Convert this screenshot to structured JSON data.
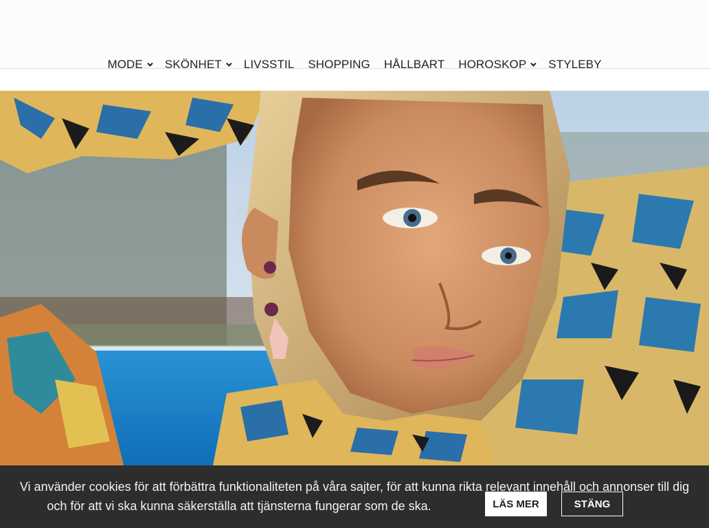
{
  "nav": {
    "items": [
      {
        "label": "MODE",
        "has_dropdown": true
      },
      {
        "label": "SKÖNHET",
        "has_dropdown": true
      },
      {
        "label": "LIVSSTIL",
        "has_dropdown": false
      },
      {
        "label": "SHOPPING",
        "has_dropdown": false
      },
      {
        "label": "HÅLLBART",
        "has_dropdown": false
      },
      {
        "label": "HOROSKOP",
        "has_dropdown": true
      },
      {
        "label": "STYLEBY",
        "has_dropdown": false
      }
    ],
    "dropdown_icon": "chevron-down-icon"
  },
  "hero": {
    "subject": "fashion portrait with patterned top in front of a swimming pool"
  },
  "cookie": {
    "line1": "Vi använder cookies för att förbättra funktionaliteten på våra sajter, för att kunna rikta relevant innehåll och annonser till dig",
    "line2": "och för att vi ska kunna säkerställa att tjänsterna fungerar som de ska.",
    "read_more_label": "LÄS MER",
    "close_label": "STÄNG"
  },
  "colors": {
    "header_bg": "#fcfcfc",
    "nav_text": "#222222",
    "cookie_bg": "#2d2d2d",
    "button_bg": "#ffffff"
  }
}
